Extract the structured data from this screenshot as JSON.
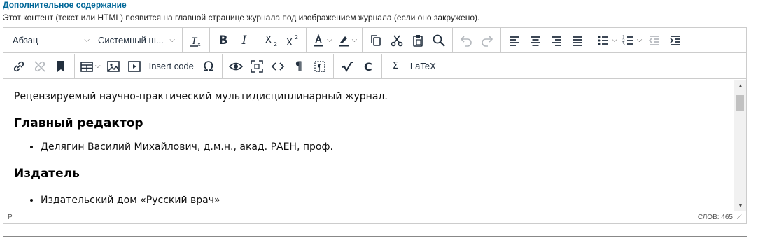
{
  "field": {
    "label": "Дополнительное содержание",
    "description": "Этот контент (текст или HTML) появится на главной странице журнала под изображением журнала (если оно закружено)."
  },
  "toolbar": {
    "block_format": "Абзац",
    "font_family": "Системный ш...",
    "clear_format_icon": "clear-formatting-icon",
    "bold": "B",
    "italic": "I",
    "insert_code": "Insert code",
    "special_char": "Ω",
    "pilcrow": "¶",
    "sigma": "Σ",
    "latex": "LaTeX"
  },
  "content": {
    "intro": "Рецензируемый научно-практический мультидисциплинарный журнал.",
    "heading1": "Главный редактор",
    "item1": "Делягин Василий Михайлович, д.м.н., акад. РАЕН, проф.",
    "heading2": "Издатель",
    "item2": "Издательский дом «Русский врач»"
  },
  "status": {
    "path": "P",
    "word_count": "СЛОВ: 465"
  },
  "colors": {
    "label": "#006798",
    "icon": "#222f3e",
    "disabled_icon": "#b4b8bd",
    "border": "#cccccc"
  }
}
